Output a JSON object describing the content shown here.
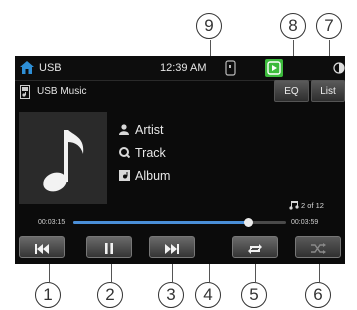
{
  "status_bar": {
    "source": "USB",
    "time": "12:39 AM"
  },
  "sub_header": {
    "title": "USB Music",
    "eq_label": "EQ",
    "list_label": "List"
  },
  "now_playing": {
    "artist": "Artist",
    "track": "Track",
    "album": "Album",
    "track_count": "2 of 12"
  },
  "progress": {
    "elapsed": "00:03:15",
    "total": "00:03:59",
    "fraction": 0.82
  },
  "controls": {
    "prev_icon": "skip-previous-icon",
    "pause_icon": "pause-icon",
    "next_icon": "skip-next-icon",
    "repeat_icon": "repeat-icon",
    "shuffle_icon": "shuffle-icon"
  },
  "callouts": [
    "1",
    "2",
    "3",
    "4",
    "5",
    "6",
    "7",
    "8",
    "9"
  ],
  "colors": {
    "screen_bg": "#0b0b0b",
    "progress_fill": "#4a8fd8",
    "music_app_icon": "#3cba3c"
  }
}
